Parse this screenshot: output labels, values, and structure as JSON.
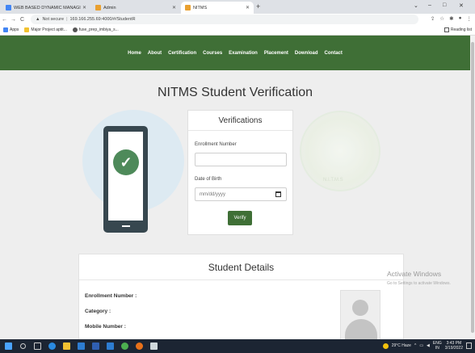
{
  "browser": {
    "tabs": [
      {
        "title": "WEB BASED DYNAMIC MANAGI",
        "active": false
      },
      {
        "title": "Admin",
        "active": false
      },
      {
        "title": "NITMS",
        "active": true
      }
    ],
    "address": {
      "security": "Not secure",
      "url": "169.166.255.69:4000/#/StudentR"
    },
    "bookmarks": [
      "Apps",
      "Major Project aptit...",
      "fuse_prep_imbiya_s..."
    ],
    "reading_list": "Reading list"
  },
  "site": {
    "nav": [
      "Home",
      "About",
      "Certification",
      "Courses",
      "Examination",
      "Placement",
      "Download",
      "Contact"
    ],
    "page_title": "NITMS Student Verification",
    "watermark_text": "N.I.T.M.S"
  },
  "verify_form": {
    "heading": "Verifications",
    "enrollment_label": "Enrollment Number",
    "enrollment_value": "",
    "dob_label": "Date of Birth",
    "dob_placeholder": "mm/dd/yyyy",
    "submit_label": "Verify"
  },
  "details": {
    "heading": "Student Details",
    "fields": [
      "Enrollment Number :",
      "Category :",
      "Mobile Number :"
    ]
  },
  "windows_notice": {
    "title": "Activate Windows",
    "subtitle": "Go to Settings to activate Windows."
  },
  "taskbar": {
    "weather": "29°C Haze",
    "lang": "ENG",
    "lang_sub": "IN",
    "time": "3:43 PM",
    "date": "3/19/2022"
  },
  "colors": {
    "brand_green": "#3f6f36",
    "check_green": "#4e8a5a"
  }
}
